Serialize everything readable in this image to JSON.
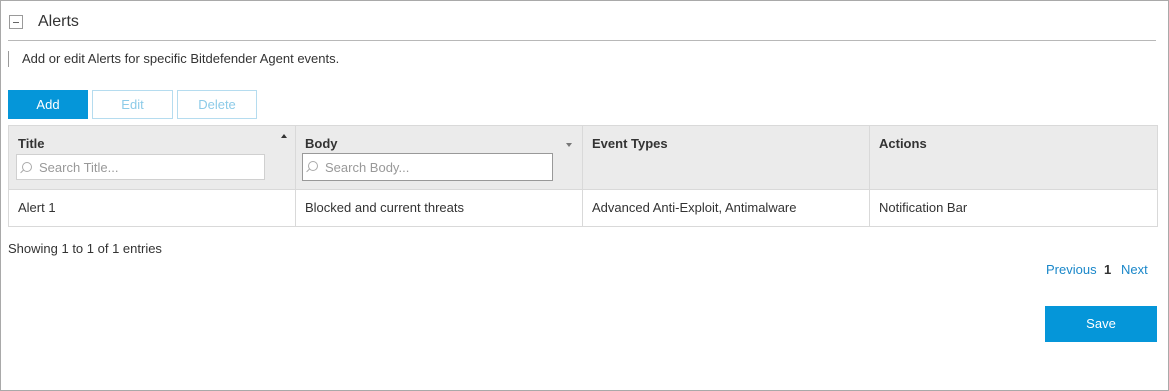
{
  "section": {
    "title": "Alerts",
    "description": "Add or edit Alerts for specific Bitdefender Agent events."
  },
  "toolbar": {
    "add_label": "Add",
    "edit_label": "Edit",
    "delete_label": "Delete"
  },
  "table": {
    "columns": [
      {
        "label": "Title",
        "search_placeholder": "Search Title..."
      },
      {
        "label": "Body",
        "search_placeholder": "Search Body..."
      },
      {
        "label": "Event Types"
      },
      {
        "label": "Actions"
      }
    ],
    "rows": [
      [
        "Alert 1",
        "Blocked and current threats",
        "Advanced Anti-Exploit, Antimalware",
        "Notification Bar"
      ]
    ]
  },
  "footer": {
    "info": "Showing 1 to 1 of 1 entries",
    "previous_label": "Previous",
    "current_page": "1",
    "next_label": "Next",
    "save_label": "Save"
  },
  "colors": {
    "primary": "#0596d9",
    "link": "#1a87c9",
    "header_bg": "#ebebeb"
  }
}
